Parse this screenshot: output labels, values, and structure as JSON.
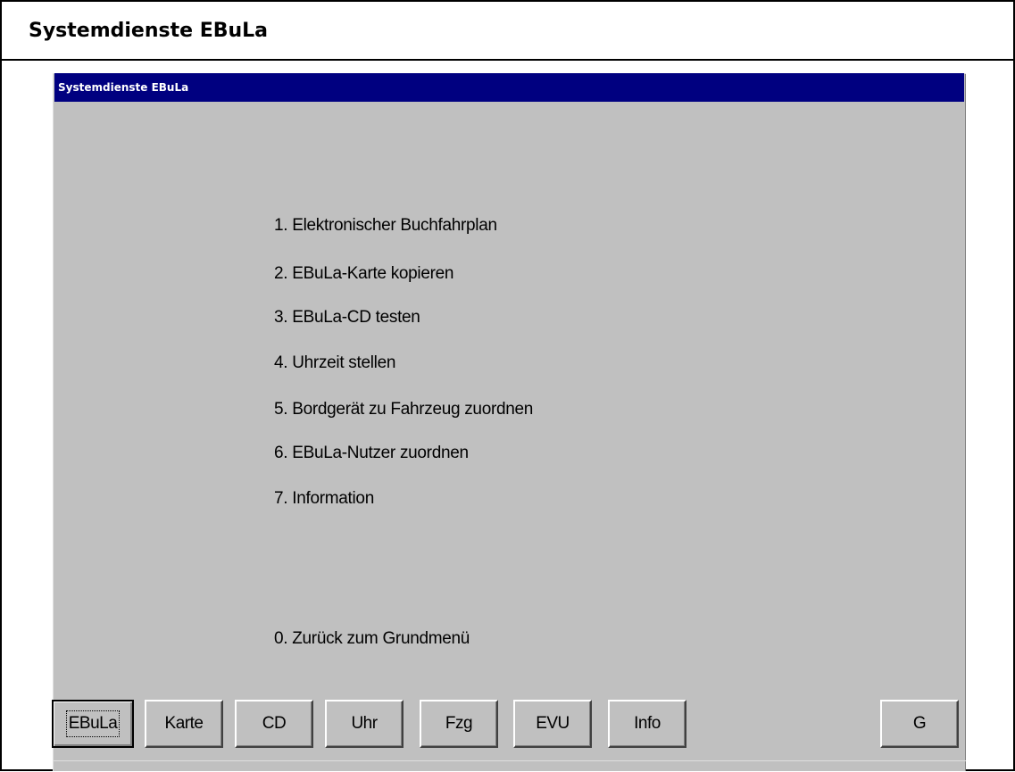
{
  "outer": {
    "title": "Systemdienste EBuLa"
  },
  "dialog": {
    "title": "Systemdienste EBuLa",
    "menu": [
      "1. Elektronischer Buchfahrplan",
      "2. EBuLa-Karte kopieren",
      "3. EBuLa-CD testen",
      "4. Uhrzeit stellen",
      "5. Bordgerät zu Fahrzeug zuordnen",
      "6. EBuLa-Nutzer zuordnen",
      "7. Information",
      "0. Zurück zum Grundmenü"
    ],
    "buttons": {
      "ebula": "EBuLa",
      "karte": "Karte",
      "cd": "CD",
      "uhr": "Uhr",
      "fzg": "Fzg",
      "evu": "EVU",
      "info": "Info",
      "g": "G"
    }
  },
  "colors": {
    "titlebar": "#000080",
    "dialog_bg": "#c0c0c0"
  }
}
